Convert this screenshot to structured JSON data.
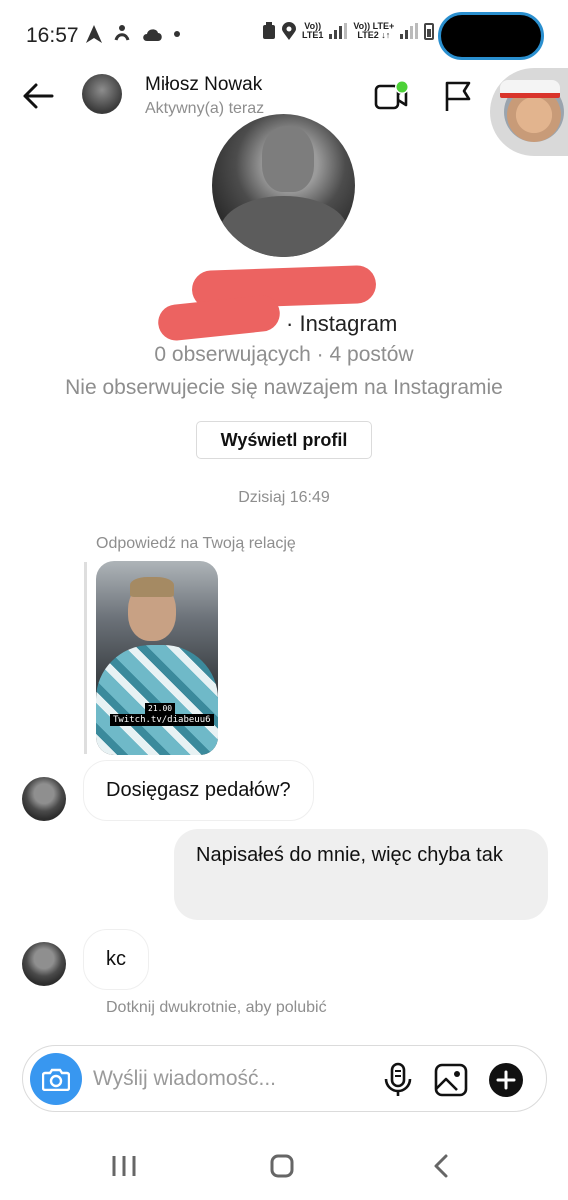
{
  "status_bar": {
    "time": "16:57",
    "sim1_top": "Vo))",
    "sim1_bottom": "LTE1",
    "sim2_top": "Vo)) LTE+",
    "sim2_bottom": "LTE2 ↓↑",
    "icons_left": [
      "navigation-icon",
      "accessibility-icon",
      "cloud-icon",
      "dot-icon"
    ],
    "icons_right": [
      "recycle-icon",
      "location-icon",
      "signal-icon",
      "battery-icon"
    ]
  },
  "header": {
    "name": "Miłosz Nowak",
    "status": "Aktywny(a) teraz",
    "online_dot_color": "#4cd137"
  },
  "profile": {
    "source": "Instagram",
    "stats": "0 obserwujących · 4 postów",
    "mutual": "Nie obserwujecie się nawzajem na Instagramie",
    "view_profile_label": "Wyświetl profil",
    "redaction_color": "#ec6361"
  },
  "conversation": {
    "date": "Dzisiaj 16:49",
    "story_reply_label": "Odpowiedź na Twoją relację",
    "story_caption_time": "21.00",
    "story_caption_link": "Twitch.tv/diabeuu6",
    "messages": [
      {
        "direction": "in",
        "text": "Dosięgasz pedałów?"
      },
      {
        "direction": "out",
        "text": "Napisałeś do mnie, więc chyba tak"
      },
      {
        "direction": "in",
        "text": "kc"
      }
    ],
    "tap_hint": "Dotknij dwukrotnie, aby polubić"
  },
  "composer": {
    "placeholder": "Wyślij wiadomość...",
    "accent_color": "#3897f0"
  }
}
